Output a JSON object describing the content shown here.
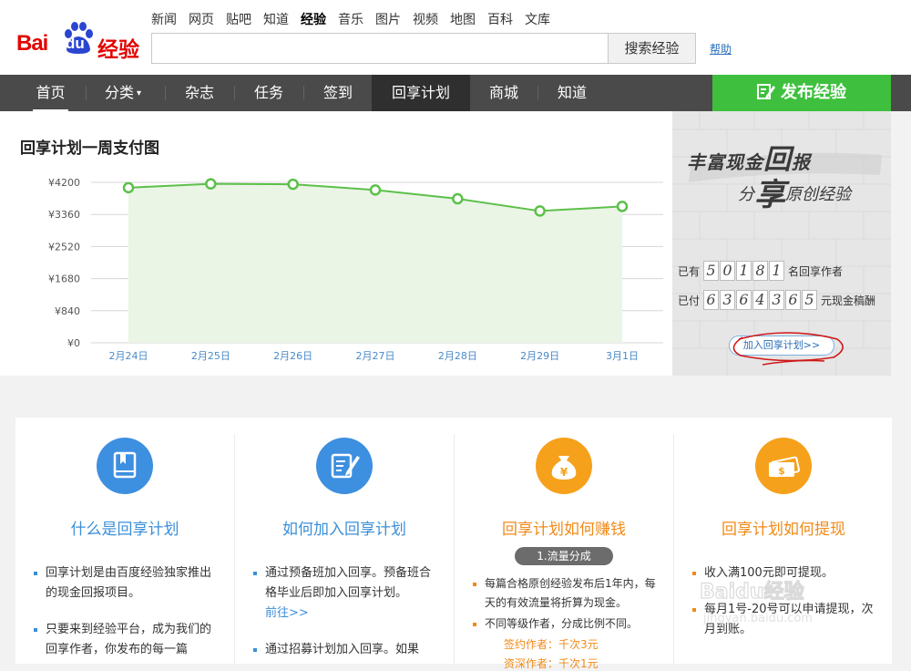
{
  "header": {
    "logo_bai": "Bai",
    "logo_du": "du",
    "logo_product": "经验",
    "topnav": [
      "新闻",
      "网页",
      "贴吧",
      "知道",
      "经验",
      "音乐",
      "图片",
      "视频",
      "地图",
      "百科",
      "文库"
    ],
    "search_button": "搜索经验",
    "help": "帮助"
  },
  "mainnav": {
    "items": [
      "首页",
      "分类",
      "杂志",
      "任务",
      "签到",
      "回享计划",
      "商城",
      "知道"
    ],
    "publish": "发布经验"
  },
  "chart_panel": {
    "title": "回享计划一周支付图"
  },
  "chart_data": {
    "type": "area",
    "categories": [
      "2月24日",
      "2月25日",
      "2月26日",
      "2月27日",
      "2月28日",
      "2月29日",
      "3月1日"
    ],
    "values": [
      4060,
      4160,
      4150,
      4000,
      3770,
      3450,
      3570
    ],
    "yticks": [
      "¥0",
      "¥840",
      "¥1680",
      "¥2520",
      "¥3360",
      "¥4200"
    ],
    "ylim": [
      0,
      4200
    ],
    "grid": true,
    "colors": {
      "line": "#5cc04a",
      "fill": "#eaf5e6",
      "axis": "#4a8ac8"
    }
  },
  "promo": {
    "slogan1_a": "丰富现金",
    "slogan1_big": "回",
    "slogan1_b": "报",
    "slogan2_a": "分",
    "slogan2_big": "享",
    "slogan2_b": "原创经验",
    "authors_prefix": "已有",
    "authors_digits": [
      "5",
      "0",
      "1",
      "8",
      "1"
    ],
    "authors_suffix": "名回享作者",
    "paid_prefix": "已付",
    "paid_digits": [
      "6",
      "3",
      "6",
      "4",
      "3",
      "6",
      "5"
    ],
    "paid_suffix": "元现金稿酬",
    "join_link": "加入回享计划>>"
  },
  "cards": [
    {
      "title": "什么是回享计划",
      "bullets": [
        "回享计划是由百度经验独家推出的现金回报项目。",
        "只要来到经验平台，成为我们的回享作者，你发布的每一篇"
      ]
    },
    {
      "title": "如何加入回享计划",
      "bullet1": "通过预备班加入回享。预备班合格毕业后即加入回享计划。",
      "bullet1_link": "前往>>",
      "bullet2": "通过招募计划加入回享。如果"
    },
    {
      "title": "回享计划如何赚钱",
      "pill": "1.流量分成",
      "bullets": [
        "每篇合格原创经验发布后1年内，每天的有效流量将折算为现金。",
        "不同等级作者，分成比例不同。"
      ],
      "extra1": "签约作者：千次3元",
      "extra2": "资深作者：千次1元"
    },
    {
      "title": "回享计划如何提现",
      "bullets": [
        "收入满100元即可提现。",
        "每月1号-20号可以申请提现，次月到账。"
      ]
    }
  ],
  "watermark": {
    "brand": "Baidu经验",
    "url": "jingyan.baidu.com"
  }
}
